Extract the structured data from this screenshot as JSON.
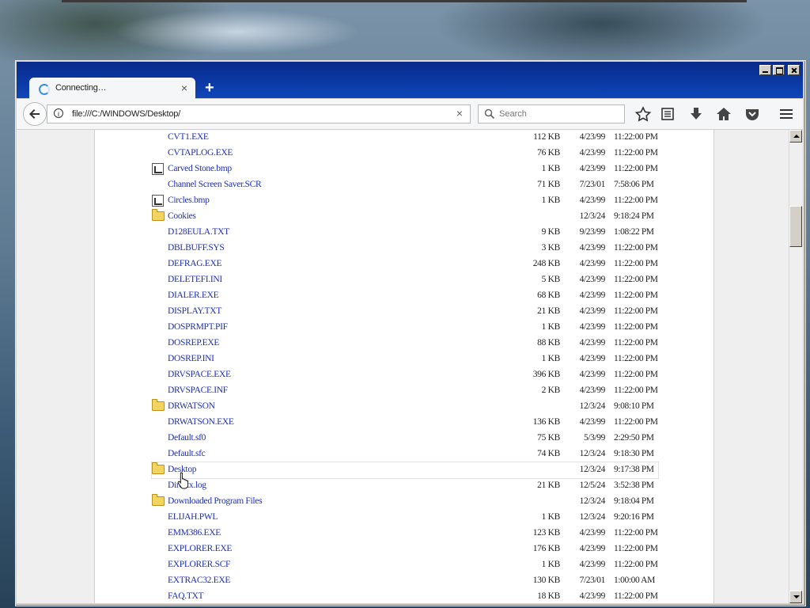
{
  "browser": {
    "tab": {
      "title": "Connecting…",
      "close_glyph": "×"
    },
    "new_tab_glyph": "+",
    "url": "file:///C:/WINDOWS/Desktop/",
    "url_clear_glyph": "×",
    "search_placeholder": "Search",
    "info_glyph": "i",
    "toolbar_icons": [
      "bookmark-star-icon",
      "reading-list-icon",
      "downloads-icon",
      "home-icon",
      "pocket-icon",
      "menu-icon"
    ]
  },
  "files": [
    {
      "name": "CVT1.EXE",
      "size": "112 KB",
      "date": "4/23/99",
      "time": "11:22:00 PM",
      "icon": "none"
    },
    {
      "name": "CVTAPLOG.EXE",
      "size": "76 KB",
      "date": "4/23/99",
      "time": "11:22:00 PM",
      "icon": "none"
    },
    {
      "name": "Carved Stone.bmp",
      "size": "1 KB",
      "date": "4/23/99",
      "time": "11:22:00 PM",
      "icon": "bmp"
    },
    {
      "name": "Channel Screen Saver.SCR",
      "size": "71 KB",
      "date": "7/23/01",
      "time": "7:58:06 PM",
      "icon": "none"
    },
    {
      "name": "Circles.bmp",
      "size": "1 KB",
      "date": "4/23/99",
      "time": "11:22:00 PM",
      "icon": "bmp"
    },
    {
      "name": "Cookies",
      "size": "",
      "date": "12/3/24",
      "time": "9:18:24 PM",
      "icon": "folder"
    },
    {
      "name": "D128EULA.TXT",
      "size": "9 KB",
      "date": "9/23/99",
      "time": "1:08:22 PM",
      "icon": "none"
    },
    {
      "name": "DBLBUFF.SYS",
      "size": "3 KB",
      "date": "4/23/99",
      "time": "11:22:00 PM",
      "icon": "none"
    },
    {
      "name": "DEFRAG.EXE",
      "size": "248 KB",
      "date": "4/23/99",
      "time": "11:22:00 PM",
      "icon": "none"
    },
    {
      "name": "DELETEFI.INI",
      "size": "5 KB",
      "date": "4/23/99",
      "time": "11:22:00 PM",
      "icon": "none"
    },
    {
      "name": "DIALER.EXE",
      "size": "68 KB",
      "date": "4/23/99",
      "time": "11:22:00 PM",
      "icon": "none"
    },
    {
      "name": "DISPLAY.TXT",
      "size": "21 KB",
      "date": "4/23/99",
      "time": "11:22:00 PM",
      "icon": "none"
    },
    {
      "name": "DOSPRMPT.PIF",
      "size": "1 KB",
      "date": "4/23/99",
      "time": "11:22:00 PM",
      "icon": "none"
    },
    {
      "name": "DOSREP.EXE",
      "size": "88 KB",
      "date": "4/23/99",
      "time": "11:22:00 PM",
      "icon": "none"
    },
    {
      "name": "DOSREP.INI",
      "size": "1 KB",
      "date": "4/23/99",
      "time": "11:22:00 PM",
      "icon": "none"
    },
    {
      "name": "DRVSPACE.EXE",
      "size": "396 KB",
      "date": "4/23/99",
      "time": "11:22:00 PM",
      "icon": "none"
    },
    {
      "name": "DRVSPACE.INF",
      "size": "2 KB",
      "date": "4/23/99",
      "time": "11:22:00 PM",
      "icon": "none"
    },
    {
      "name": "DRWATSON",
      "size": "",
      "date": "12/3/24",
      "time": "9:08:10 PM",
      "icon": "folder"
    },
    {
      "name": "DRWATSON.EXE",
      "size": "136 KB",
      "date": "4/23/99",
      "time": "11:22:00 PM",
      "icon": "none"
    },
    {
      "name": "Default.sf0",
      "size": "75 KB",
      "date": "5/3/99",
      "time": "2:29:50 PM",
      "icon": "none"
    },
    {
      "name": "Default.sfc",
      "size": "74 KB",
      "date": "12/3/24",
      "time": "9:18:30 PM",
      "icon": "none"
    },
    {
      "name": "Desktop",
      "size": "",
      "date": "12/3/24",
      "time": "9:17:38 PM",
      "icon": "folder",
      "hovered": true
    },
    {
      "name": "Directx.log",
      "size": "21 KB",
      "date": "12/5/24",
      "time": "3:52:38 PM",
      "icon": "none"
    },
    {
      "name": "Downloaded Program Files",
      "size": "",
      "date": "12/3/24",
      "time": "9:18:04 PM",
      "icon": "folder"
    },
    {
      "name": "ELIJAH.PWL",
      "size": "1 KB",
      "date": "12/3/24",
      "time": "9:20:16 PM",
      "icon": "none"
    },
    {
      "name": "EMM386.EXE",
      "size": "123 KB",
      "date": "4/23/99",
      "time": "11:22:00 PM",
      "icon": "none"
    },
    {
      "name": "EXPLORER.EXE",
      "size": "176 KB",
      "date": "4/23/99",
      "time": "11:22:00 PM",
      "icon": "none"
    },
    {
      "name": "EXPLORER.SCF",
      "size": "1 KB",
      "date": "4/23/99",
      "time": "11:22:00 PM",
      "icon": "none"
    },
    {
      "name": "EXTRAC32.EXE",
      "size": "130 KB",
      "date": "7/23/01",
      "time": "1:00:00 AM",
      "icon": "none"
    },
    {
      "name": "FAQ.TXT",
      "size": "18 KB",
      "date": "4/23/99",
      "time": "11:22:00 PM",
      "icon": "none"
    }
  ]
}
